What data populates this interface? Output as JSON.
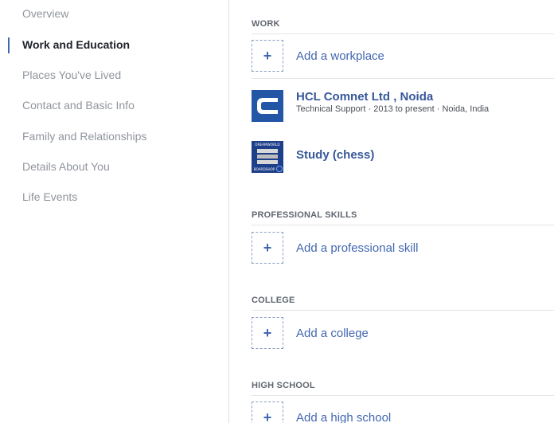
{
  "sidebar": {
    "items": [
      {
        "label": "Overview"
      },
      {
        "label": "Work and Education"
      },
      {
        "label": "Places You've Lived"
      },
      {
        "label": "Contact and Basic Info"
      },
      {
        "label": "Family and Relationships"
      },
      {
        "label": "Details About You"
      },
      {
        "label": "Life Events"
      }
    ]
  },
  "work": {
    "title": "WORK",
    "add_label": "Add a workplace",
    "plus": "+",
    "entries": [
      {
        "name": "HCL Comnet Ltd , Noida",
        "detail": "Technical Support · 2013 to present · Noida, India"
      },
      {
        "name": "Study (chess)",
        "logo_lines": [
          "DREAMWORLD",
          "BOARDSHOP"
        ]
      }
    ]
  },
  "skills": {
    "title": "PROFESSIONAL SKILLS",
    "add_label": "Add a professional skill",
    "plus": "+"
  },
  "college": {
    "title": "COLLEGE",
    "add_label": "Add a college",
    "plus": "+"
  },
  "high_school": {
    "title": "HIGH SCHOOL",
    "add_label": "Add a high school",
    "plus": "+"
  },
  "colors": {
    "accent": "#4267b2",
    "link": "#365899",
    "muted": "#90949c"
  }
}
